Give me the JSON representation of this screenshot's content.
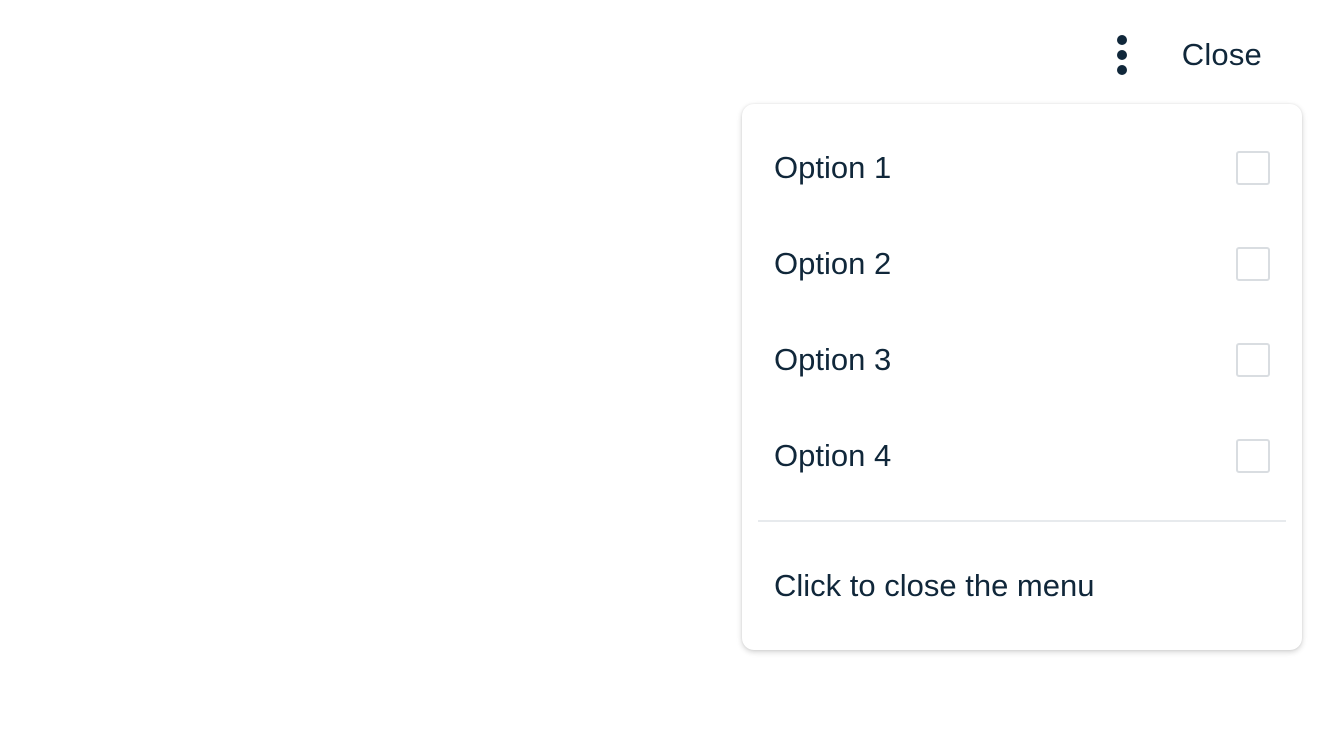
{
  "header": {
    "more_icon": "vertical-dots-icon",
    "close_label": "Close"
  },
  "menu": {
    "items": [
      {
        "label": "Option 1",
        "checked": false
      },
      {
        "label": "Option 2",
        "checked": false
      },
      {
        "label": "Option 3",
        "checked": false
      },
      {
        "label": "Option 4",
        "checked": false
      }
    ],
    "close_label": "Click to close the menu"
  },
  "colors": {
    "text": "#10273a",
    "checkbox_border": "#d9dde1",
    "divider": "#e7eaed",
    "background": "#ffffff"
  }
}
